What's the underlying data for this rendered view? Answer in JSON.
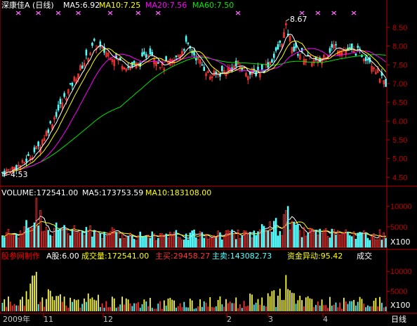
{
  "price_panel": {
    "stock_name": "深康佳A",
    "period": "(日线)",
    "ma5_label": "MA5:6.92",
    "ma10_label": "MA10:7.25",
    "ma20_label": "MA20:7.56",
    "ma60_label": "MA60:7.50",
    "high_label": "8.67",
    "low_label": "4.53",
    "ylim": [
      4.3,
      8.95
    ],
    "y_ticks": [
      "8.50",
      "8.00",
      "7.50",
      "7.00",
      "6.50",
      "6.00",
      "5.50",
      "5.00",
      "4.50"
    ]
  },
  "volume_panel": {
    "volume_label": "VOLUME:172541.00",
    "ma5_label": "MA5:173753.59",
    "ma10_label": "MA10:183108.00",
    "y_ticks": [
      "10000",
      "5000"
    ],
    "unit": "X100"
  },
  "flow_panel": {
    "source": "股参网制作",
    "a_shares": "A股:6.00",
    "turnover": "成交量:172541.00",
    "main_buy": "主买:29458.27",
    "main_sell": "主卖:143082.73",
    "fund_move": "资金异动:95.42",
    "deal": "成交",
    "y_ticks": [
      "10000",
      "5000"
    ],
    "unit": "X100"
  },
  "time_axis": {
    "labels": [
      "2009年",
      "11",
      "12",
      "2",
      "3",
      "4"
    ],
    "period_button": "日线"
  },
  "colors": {
    "up": "#ff3232",
    "down": "#54ffff",
    "ma5": "#ffffff",
    "ma10": "#ffff00",
    "ma20": "#ff00ff",
    "ma60": "#00e600",
    "axis": "#c00000",
    "marker": "#ff66ff",
    "flow_bar": "#ffff3c"
  },
  "chart_data": {
    "type": "candlestick",
    "x_axis_labels": [
      "2009年",
      "11",
      "12",
      "2",
      "3",
      "4"
    ],
    "price_range": [
      4.53,
      8.67
    ],
    "last_close": 6.92,
    "price_path_keypoints": [
      [
        0,
        4.62
      ],
      [
        10,
        4.85
      ],
      [
        18,
        5.3
      ],
      [
        28,
        6.3
      ],
      [
        38,
        7.3
      ],
      [
        46,
        8.05
      ],
      [
        50,
        7.9
      ],
      [
        56,
        7.7
      ],
      [
        63,
        7.45
      ],
      [
        68,
        7.5
      ],
      [
        74,
        7.9
      ],
      [
        80,
        7.45
      ],
      [
        86,
        7.6
      ],
      [
        92,
        8.05
      ],
      [
        98,
        7.65
      ],
      [
        104,
        7.2
      ],
      [
        110,
        7.3
      ],
      [
        118,
        7.5
      ],
      [
        124,
        7.25
      ],
      [
        130,
        7.35
      ],
      [
        136,
        7.7
      ],
      [
        140,
        8.15
      ],
      [
        142,
        8.5
      ],
      [
        146,
        7.9
      ],
      [
        152,
        7.7
      ],
      [
        158,
        7.55
      ],
      [
        162,
        7.8
      ],
      [
        166,
        8.0
      ],
      [
        172,
        7.9
      ],
      [
        178,
        7.85
      ],
      [
        184,
        7.65
      ],
      [
        188,
        7.3
      ],
      [
        192,
        6.92
      ]
    ],
    "volume_path_keypoints": [
      [
        0,
        3000
      ],
      [
        10,
        3500
      ],
      [
        14,
        6000
      ],
      [
        16,
        9000
      ],
      [
        17,
        11000
      ],
      [
        18,
        7500
      ],
      [
        22,
        5000
      ],
      [
        30,
        4000
      ],
      [
        45,
        3800
      ],
      [
        60,
        3200
      ],
      [
        80,
        2800
      ],
      [
        100,
        3000
      ],
      [
        120,
        3400
      ],
      [
        140,
        5200
      ],
      [
        142,
        8700
      ],
      [
        144,
        5500
      ],
      [
        150,
        3500
      ],
      [
        170,
        3000
      ],
      [
        192,
        3100
      ]
    ]
  }
}
